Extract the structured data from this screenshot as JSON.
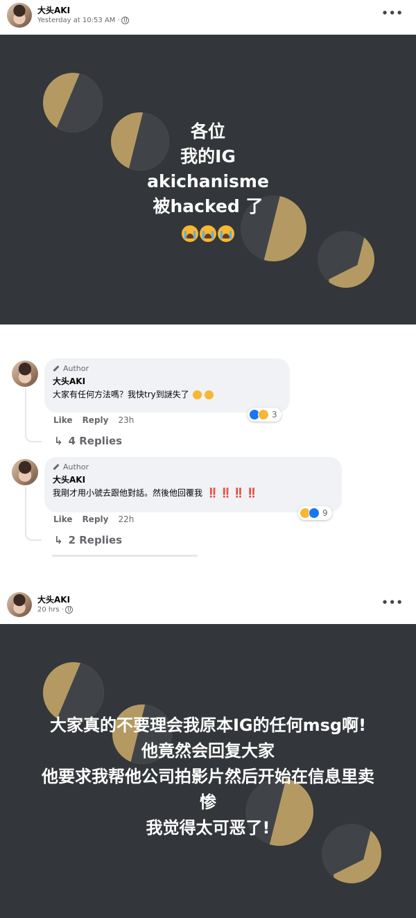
{
  "post1": {
    "author": "大头AKI",
    "timestamp": "Yesterday at 10:53 AM ·",
    "more_label": "•••",
    "image_lines": [
      "各位",
      "我的IG",
      "akichanisme",
      "被hacked 了"
    ]
  },
  "comments": [
    {
      "badge": "Author",
      "name": "大头AKI",
      "text": "大家有任何方法嗎？我快try到謎失了",
      "like": "Like",
      "reply": "Reply",
      "time": "23h",
      "reaction_count": "3",
      "replies": "4 Replies"
    },
    {
      "badge": "Author",
      "name": "大头AKI",
      "text": "我剛才用小號去跟他對話。然後他回覆我",
      "bangs": "‼️ ‼️ ‼️ ‼️",
      "like": "Like",
      "reply": "Reply",
      "time": "22h",
      "reaction_count": "9",
      "replies": "2 Replies"
    }
  ],
  "post2": {
    "author": "大头AKI",
    "timestamp": "20 hrs ·",
    "more_label": "•••",
    "image_lines": [
      "大家真的不要理会我原本IG的任何msg啊!",
      "他竟然会回复大家",
      "他要求我帮他公司拍影片然后开始在信息里卖",
      "惨",
      "我觉得太可恶了!"
    ]
  },
  "colors": {
    "image_bg": "#33363a",
    "moon_gold": "#b49a62",
    "moon_dark": "#404448",
    "meta_text": "#65676b",
    "bubble_bg": "#f0f2f5"
  }
}
